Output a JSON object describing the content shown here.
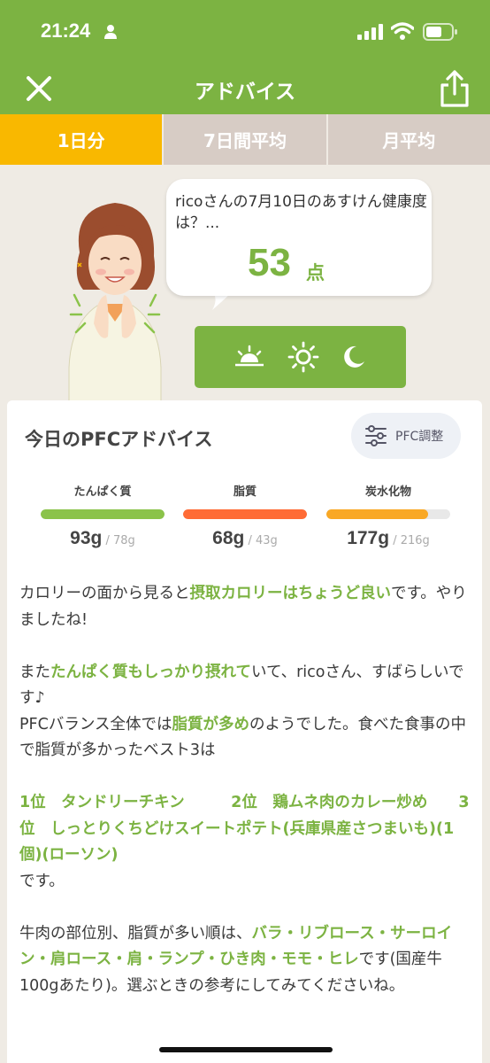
{
  "status_bar": {
    "time": "21:24"
  },
  "nav": {
    "title": "アドバイス"
  },
  "tabs": [
    {
      "label": "1日分",
      "active": true
    },
    {
      "label": "7日間平均",
      "active": false
    },
    {
      "label": "月平均",
      "active": false
    }
  ],
  "bubble": {
    "question": "ricoさんの7月10日のあすけん健康度は？...",
    "score": "53",
    "score_unit": "点"
  },
  "card": {
    "title": "今日のPFCアドバイス",
    "pfc_button": "PFC調整",
    "macros": [
      {
        "name": "たんぱく質",
        "value": "93g",
        "target": "/ 78g",
        "fill_fraction": 1.0,
        "color": "#8bc34a"
      },
      {
        "name": "脂質",
        "value": "68g",
        "target": "/ 43g",
        "fill_fraction": 1.0,
        "color": "#ff6b35"
      },
      {
        "name": "炭水化物",
        "value": "177g",
        "target": "/ 216g",
        "fill_fraction": 0.82,
        "color": "#f9a825"
      }
    ],
    "advice": {
      "p1_a": "カロリーの面から見ると",
      "p1_hl": "摂取カロリーはちょうど良い",
      "p1_b": "です。やりましたね!",
      "p2_a": "また",
      "p2_hl": "たんぱく質もしっかり摂れて",
      "p2_b": "いて、ricoさん、すばらしいです♪",
      "p3_a": "PFCバランス全体では",
      "p3_hl": "脂質が多め",
      "p3_b": "のようでした。食べた食事の中で脂質が多かったベスト3は",
      "p4_hl": "1位　タンドリーチキン　　　2位　鶏ムネ肉のカレー炒め　　3位　しっとりくちどけスイートポテト(兵庫県産さつまいも)(1個)(ローソン)",
      "p4_b": "です。",
      "p5_a": "牛肉の部位別、脂質が多い順は、",
      "p5_hl": "バラ・リブロース・サーロイン・肩ロース・肩・ランプ・ひき肉・モモ・ヒレ",
      "p5_b": "です(国産牛100gあたり)。選ぶときの参考にしてみてくださいね。"
    }
  },
  "colors": {
    "brand_green": "#7cb342",
    "tab_active": "#f9b800",
    "tab_inactive": "#d7ccc5"
  }
}
